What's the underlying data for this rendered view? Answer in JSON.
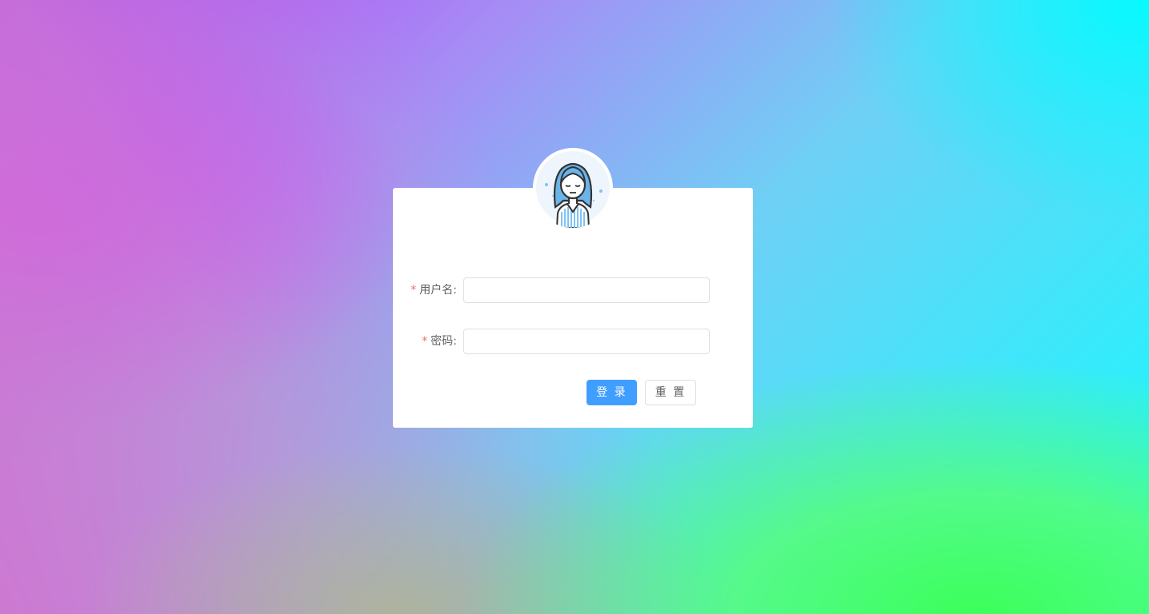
{
  "login_form": {
    "username_label": "用户名:",
    "username_value": "",
    "password_label": "密码:",
    "password_value": "",
    "required_mark": "*",
    "login_button": "登 录",
    "reset_button": "重 置"
  },
  "colors": {
    "primary": "#409eff",
    "required": "#f56c6c"
  },
  "icons": {
    "avatar": "user-avatar-icon"
  }
}
